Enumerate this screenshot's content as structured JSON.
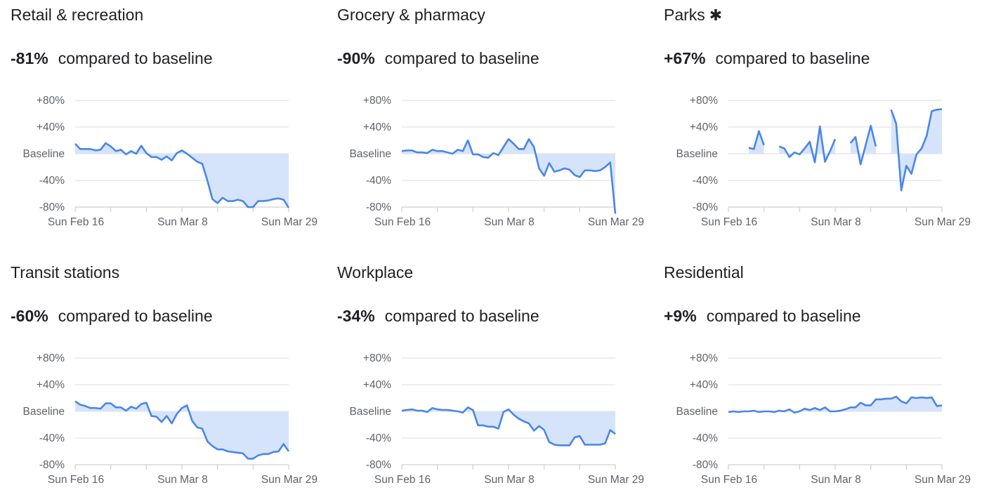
{
  "colors": {
    "line": "#4a86e8",
    "fill": "#d6e4fb",
    "grid": "#e3e3e3",
    "axis_text": "#5f6368"
  },
  "headline_suffix": "compared to baseline",
  "chart_data": [
    {
      "type": "line",
      "title": "Retail & recreation",
      "headline": "-81%",
      "asterisk": false,
      "ylim": [
        -80,
        80
      ],
      "yticks": [
        80,
        40,
        0,
        -40,
        -80
      ],
      "ytick_labels": [
        "+80%",
        "+40%",
        "Baseline",
        "-40%",
        "-80%"
      ],
      "xtick_labels": [
        "Sun Feb 16",
        "Sun Mar 8",
        "Sun Mar 29"
      ],
      "grid": true,
      "x_range": [
        "Feb 16",
        "Mar 29"
      ],
      "values": [
        15,
        7,
        7,
        7,
        5,
        6,
        16,
        11,
        4,
        6,
        -1,
        4,
        0,
        12,
        1,
        -5,
        -5,
        -9,
        -4,
        -10,
        1,
        5,
        0,
        -6,
        -12,
        -15,
        -40,
        -68,
        -74,
        -66,
        -71,
        -71,
        -69,
        -71,
        -80,
        -80,
        -71,
        -71,
        -70,
        -68,
        -67,
        -69,
        -81
      ]
    },
    {
      "type": "line",
      "title": "Grocery & pharmacy",
      "headline": "-90%",
      "asterisk": false,
      "ylim": [
        -80,
        80
      ],
      "yticks": [
        80,
        40,
        0,
        -40,
        -80
      ],
      "ytick_labels": [
        "+80%",
        "+40%",
        "Baseline",
        "-40%",
        "-80%"
      ],
      "xtick_labels": [
        "Sun Feb 16",
        "Sun Mar 8",
        "Sun Mar 29"
      ],
      "grid": true,
      "x_range": [
        "Feb 16",
        "Mar 29"
      ],
      "values": [
        4,
        5,
        5,
        2,
        2,
        1,
        6,
        4,
        4,
        2,
        0,
        6,
        4,
        20,
        -1,
        -1,
        -5,
        -6,
        1,
        -2,
        10,
        22,
        15,
        7,
        7,
        22,
        10,
        -22,
        -33,
        -14,
        -27,
        -25,
        -22,
        -24,
        -32,
        -35,
        -25,
        -25,
        -26,
        -25,
        -20,
        -13,
        -90
      ]
    },
    {
      "type": "line",
      "title": "Parks",
      "headline": "+67%",
      "asterisk": true,
      "ylim": [
        -80,
        80
      ],
      "yticks": [
        80,
        40,
        0,
        -40,
        -80
      ],
      "ytick_labels": [
        "+80%",
        "+40%",
        "Baseline",
        "-40%",
        "-80%"
      ],
      "xtick_labels": [
        "Sun Feb 16",
        "Sun Mar 8",
        "Sun Mar 29"
      ],
      "grid": true,
      "x_range": [
        "Feb 16",
        "Mar 29"
      ],
      "values": [
        null,
        null,
        null,
        null,
        9,
        7,
        34,
        13,
        null,
        null,
        11,
        8,
        -5,
        2,
        -1,
        8,
        18,
        -13,
        41,
        -12,
        4,
        22,
        null,
        null,
        16,
        25,
        -16,
        13,
        42,
        11,
        null,
        null,
        66,
        45,
        -55,
        -18,
        -30,
        -1,
        8,
        27,
        64,
        66,
        67
      ]
    },
    {
      "type": "line",
      "title": "Transit stations",
      "headline": "-60%",
      "asterisk": false,
      "ylim": [
        -80,
        80
      ],
      "yticks": [
        80,
        40,
        0,
        -40,
        -80
      ],
      "ytick_labels": [
        "+80%",
        "+40%",
        "Baseline",
        "-40%",
        "-80%"
      ],
      "xtick_labels": [
        "Sun Feb 16",
        "Sun Mar 8",
        "Sun Mar 29"
      ],
      "grid": true,
      "x_range": [
        "Feb 16",
        "Mar 29"
      ],
      "values": [
        15,
        10,
        8,
        5,
        5,
        4,
        12,
        12,
        6,
        6,
        1,
        7,
        4,
        11,
        13,
        -7,
        -8,
        -16,
        -7,
        -18,
        -4,
        5,
        9,
        -14,
        -24,
        -26,
        -45,
        -52,
        -57,
        -57,
        -60,
        -61,
        -62,
        -63,
        -71,
        -71,
        -66,
        -64,
        -64,
        -61,
        -60,
        -49,
        -60
      ]
    },
    {
      "type": "line",
      "title": "Workplace",
      "headline": "-34%",
      "asterisk": false,
      "ylim": [
        -80,
        80
      ],
      "yticks": [
        80,
        40,
        0,
        -40,
        -80
      ],
      "ytick_labels": [
        "+80%",
        "+40%",
        "Baseline",
        "-40%",
        "-80%"
      ],
      "xtick_labels": [
        "Sun Feb 16",
        "Sun Mar 8",
        "Sun Mar 29"
      ],
      "grid": true,
      "x_range": [
        "Feb 16",
        "Mar 29"
      ],
      "values": [
        1,
        2,
        3,
        1,
        1,
        -1,
        5,
        3,
        2,
        2,
        1,
        0,
        -2,
        6,
        2,
        -21,
        -21,
        -23,
        -23,
        -26,
        -1,
        3,
        -5,
        -11,
        -15,
        -18,
        -29,
        -22,
        -28,
        -46,
        -50,
        -51,
        -51,
        -51,
        -39,
        -37,
        -50,
        -50,
        -50,
        -50,
        -48,
        -28,
        -34
      ]
    },
    {
      "type": "line",
      "title": "Residential",
      "headline": "+9%",
      "asterisk": false,
      "ylim": [
        -80,
        80
      ],
      "yticks": [
        80,
        40,
        0,
        -40,
        -80
      ],
      "ytick_labels": [
        "+80%",
        "+40%",
        "Baseline",
        "-40%",
        "-80%"
      ],
      "xtick_labels": [
        "Sun Feb 16",
        "Sun Mar 8",
        "Sun Mar 29"
      ],
      "grid": true,
      "x_range": [
        "Feb 16",
        "Mar 29"
      ],
      "values": [
        -1,
        0,
        -1,
        0,
        0,
        1,
        -1,
        0,
        0,
        -1,
        1,
        0,
        3,
        -2,
        0,
        4,
        2,
        5,
        2,
        6,
        0,
        0,
        1,
        3,
        6,
        6,
        13,
        9,
        9,
        18,
        18,
        19,
        19,
        22,
        15,
        12,
        21,
        20,
        21,
        20,
        21,
        8,
        9
      ]
    }
  ]
}
